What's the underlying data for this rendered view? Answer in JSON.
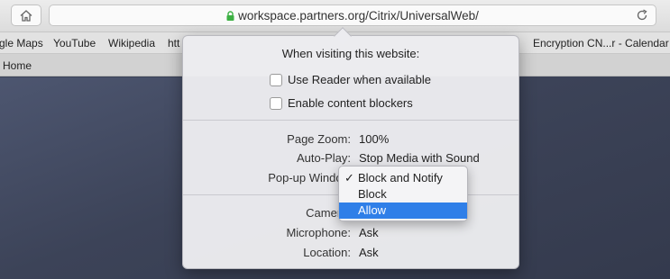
{
  "toolbar": {
    "home_icon": "home-icon",
    "url": "workspace.partners.org/Citrix/UniversalWeb/",
    "lock_icon": "lock-icon",
    "reload_icon": "reload-icon"
  },
  "bookmarks": {
    "items": [
      "gle Maps",
      "YouTube",
      "Wikipedia",
      "htt",
      "Encryption CN...r - Calendar"
    ]
  },
  "tab": {
    "title": "Home"
  },
  "popover": {
    "heading": "When visiting this website:",
    "options": [
      {
        "label": "Use Reader when available",
        "checked": false
      },
      {
        "label": "Enable content blockers",
        "checked": false
      }
    ],
    "settings": [
      {
        "label": "Page Zoom:",
        "value": "100%"
      },
      {
        "label": "Auto-Play:",
        "value": "Stop Media with Sound"
      },
      {
        "label": "Pop-up Window",
        "value": ""
      },
      {
        "label": "Camera:",
        "value": ""
      },
      {
        "label": "Microphone:",
        "value": "Ask"
      },
      {
        "label": "Location:",
        "value": "Ask"
      }
    ]
  },
  "dropdown": {
    "options": [
      "Block and Notify",
      "Block",
      "Allow"
    ],
    "checked_index": 0,
    "highlighted_index": 2,
    "check_glyph": "✓"
  },
  "colors": {
    "lock_green": "#3cb043",
    "highlight": "#2f7fe8",
    "background": "#3b4257"
  }
}
